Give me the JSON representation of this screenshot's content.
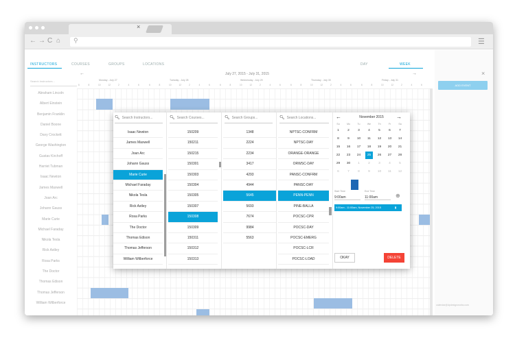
{
  "browser": {
    "tab_close": "×",
    "nav_back": "←",
    "nav_forward": "→",
    "nav_reload": "C",
    "nav_home": "⌂",
    "search_glyph": "⚲",
    "menu_glyph": "☰"
  },
  "view_tabs": {
    "instructors": "INSTRUCTORS",
    "courses": "COURSES",
    "groups": "GROUPS",
    "locations": "LOCATIONS",
    "day": "DAY",
    "week": "WEEK"
  },
  "week_label": "July 27, 2015 - July 31, 2015",
  "days": [
    "Monday - July 27",
    "Tuesday - July 28",
    "Wednesday - July 29",
    "Thursday - July 30",
    "Friday - July 31"
  ],
  "hour_ticks": "6 8 10 12 2 4 6",
  "left_search_placeholder": "Search Instructors...",
  "instructors": [
    "Abraham Lincoln",
    "Albert Einstein",
    "Benjamin Franklin",
    "Daniel Boone",
    "Davy Crockett",
    "George Washington",
    "Gustav Kirchoff",
    "Harriet Tubman",
    "Isaac Newton",
    "James Maxwell",
    "Joan Arc",
    "Johann Gauss",
    "Marie Curie",
    "Michael Faraday",
    "Nikola Tesla",
    "Rick Astley",
    "Rosa Parks",
    "The Doctor",
    "Thomas Edison",
    "Thomas Jefferson",
    "William Wilberforce"
  ],
  "right_panel": {
    "add_event": "ADD EVENT",
    "close": "×",
    "email": "calendar@dpdesignworks.com"
  },
  "overlay": {
    "instructors_search": "Search Instructors...",
    "instructors_list": [
      "Isaac Newton",
      "James Maxwell",
      "Joan Arc",
      "Johann Gauss",
      "Marie Curie",
      "Michael Faraday",
      "Nikola Tesla",
      "Rick Astley",
      "Rosa Parks",
      "The Doctor",
      "Thomas Edison",
      "Thomas Jefferson",
      "William Wilberforce"
    ],
    "instructors_selected": "Marie Curie",
    "courses_search": "Search Courses...",
    "courses_list": [
      "150209",
      "150211",
      "150215",
      "150301",
      "150303",
      "150304",
      "150305",
      "150307",
      "150308",
      "150309",
      "150311",
      "150312",
      "150313"
    ],
    "courses_selected": "150308",
    "groups_search": "Search Groups...",
    "groups_list": [
      "1348",
      "2224",
      "2234",
      "3417",
      "4293",
      "4944",
      "5645",
      "5693",
      "7674",
      "9984",
      "5563"
    ],
    "groups_selected": "5645",
    "locations_search": "Search Locations...",
    "locations_list": [
      "NPTSC-CONFRM",
      "NPTSC-DAY",
      "ORANGE-ORANGE",
      "ORWSC-DAY",
      "PANSC-CONFRM",
      "PANSC-DAY",
      "PENN-PENN",
      "PINE-BALLA",
      "POCSC-CPR",
      "POCSC-DAY",
      "POCSC-EMERG",
      "POCSC-LCR",
      "POCSC-LOAD"
    ],
    "locations_selected": "PENN-PENN",
    "calendar": {
      "month": "November 2015",
      "dow": [
        "Su",
        "Mo",
        "Tu",
        "We",
        "Th",
        "Fr",
        "Sa"
      ],
      "weeks": [
        [
          "1",
          "2",
          "3",
          "4",
          "5",
          "6",
          "7"
        ],
        [
          "8",
          "9",
          "10",
          "11",
          "12",
          "13",
          "14"
        ],
        [
          "15",
          "16",
          "17",
          "18",
          "19",
          "20",
          "21"
        ],
        [
          "22",
          "23",
          "24",
          "25",
          "26",
          "27",
          "28"
        ],
        [
          "29",
          "30",
          "1",
          "2",
          "3",
          "4",
          "5"
        ],
        [
          "6",
          "7",
          "8",
          "9",
          "10",
          "11",
          "12"
        ]
      ],
      "selected_day": "25",
      "start_label": "Start Time",
      "end_label": "End Time",
      "start_time": "9:00am",
      "end_time": "11:00am",
      "event_summary": "9:00am - 11:00am, November 25, 2015",
      "okay": "OKAY",
      "delete": "DELETE"
    }
  },
  "colors": {
    "accent": "#0aa3d9",
    "event": "#9bbde3",
    "delete": "#f44336",
    "mini_bar": "#1e67b4"
  }
}
